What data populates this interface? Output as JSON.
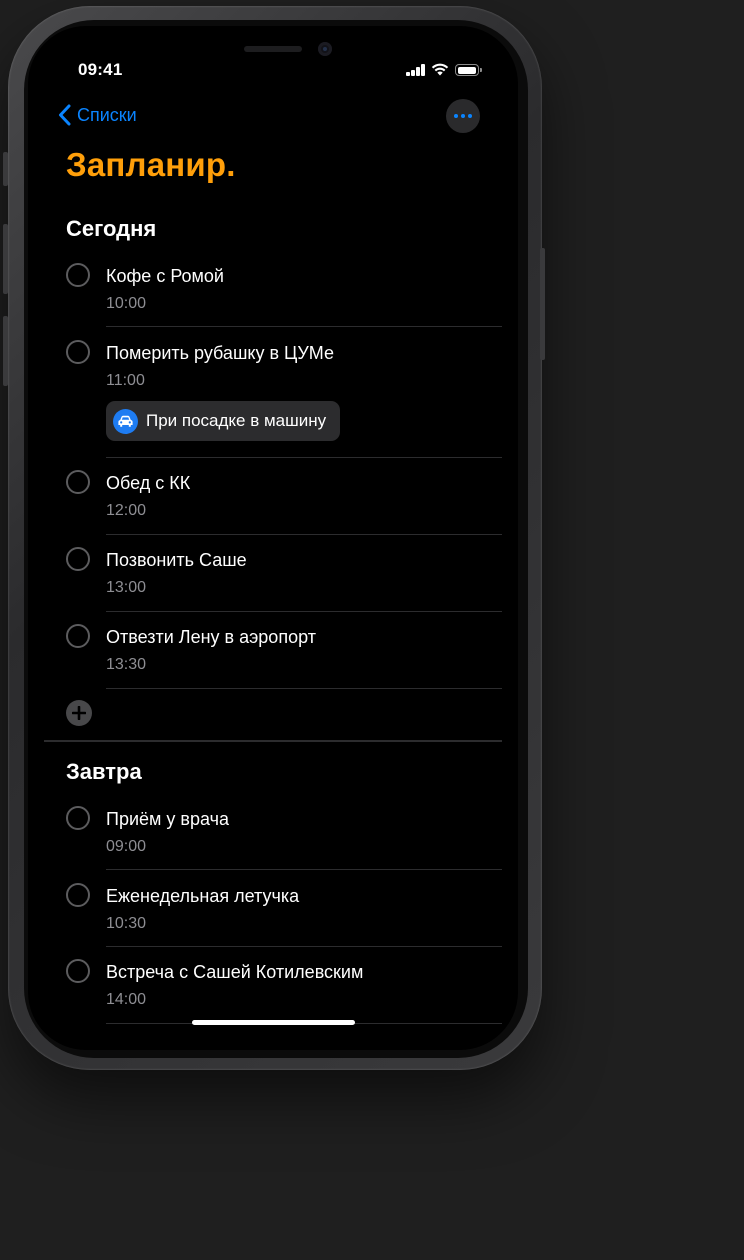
{
  "status_bar": {
    "time": "09:41",
    "battery_level": 1.0
  },
  "nav": {
    "back_label": "Списки"
  },
  "page": {
    "title": "Запланир."
  },
  "colors": {
    "accent": "#0a84ff",
    "title": "#ff9f0a",
    "background": "#000000"
  },
  "sections": [
    {
      "title": "Сегодня",
      "items": [
        {
          "title": "Кофе с Ромой",
          "time": "10:00"
        },
        {
          "title": "Померить рубашку в ЦУМе",
          "time": "11:00",
          "chip": {
            "icon": "car-icon",
            "label": "При посадке в машину"
          }
        },
        {
          "title": "Обед с КК",
          "time": "12:00"
        },
        {
          "title": "Позвонить Саше",
          "time": "13:00"
        },
        {
          "title": "Отвезти Лену в аэропорт",
          "time": "13:30"
        }
      ]
    },
    {
      "title": "Завтра",
      "items": [
        {
          "title": "Приём у врача",
          "time": "09:00"
        },
        {
          "title": "Еженедельная летучка",
          "time": "10:30"
        },
        {
          "title": "Встреча с Сашей Котилевским",
          "time": "14:00"
        }
      ]
    }
  ]
}
